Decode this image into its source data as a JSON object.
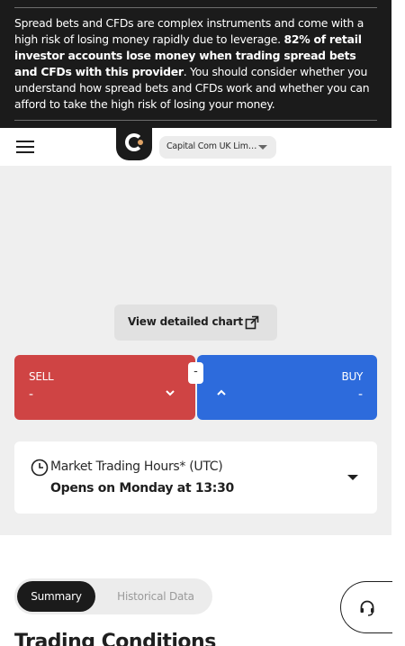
{
  "risk_warning": {
    "text_start": "Spread bets and CFDs are complex instruments and come with a high risk of losing money rapidly due to leverage. ",
    "text_bold": "82% of retail investor accounts lose money when trading spread bets and CFDs with this provider",
    "text_end": ". You should consider whether you understand how spread bets and CFDs work and whether you can afford to take the high risk of losing your money."
  },
  "header": {
    "menu_icon": "hamburger-menu-icon",
    "logo_icon": "capital-com-logo",
    "entity_selector": "Capital Com UK Lim…"
  },
  "chart": {
    "detail_button_label": "View detailed chart",
    "detail_button_icon": "expand-icon"
  },
  "trade": {
    "sell_label": "SELL",
    "sell_value": "-",
    "buy_label": "BUY",
    "buy_value": "-",
    "spread_value": "-",
    "sell_color": "#cf4444",
    "buy_color": "#2d6bdc"
  },
  "market_hours": {
    "title": "Market Trading Hours* (UTC)",
    "status": "Opens on Monday at 13:30",
    "icon": "clock-icon"
  },
  "tabs": [
    {
      "label": "Summary",
      "active": true
    },
    {
      "label": "Historical Data",
      "active": false
    }
  ],
  "section": {
    "title": "Trading Conditions"
  },
  "support": {
    "icon": "headset-icon"
  }
}
